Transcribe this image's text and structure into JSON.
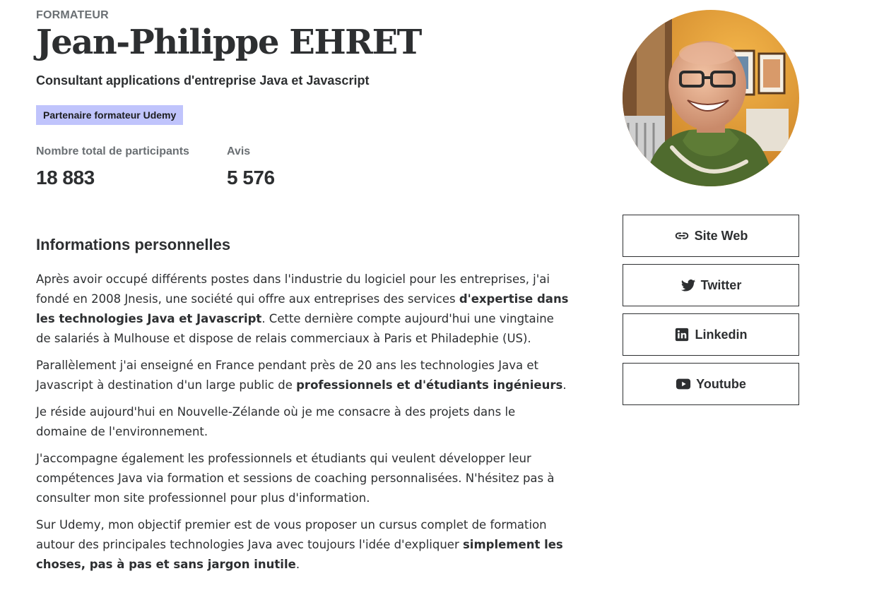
{
  "profile": {
    "eyebrow": "FORMATEUR",
    "name": "Jean-Philippe EHRET",
    "headline": "Consultant applications d'entreprise Java et Javascript",
    "badge": "Partenaire formateur Udemy",
    "avatar_alt": "Jean-Philippe EHRET"
  },
  "stats": [
    {
      "label": "Nombre total de participants",
      "value": "18 883"
    },
    {
      "label": "Avis",
      "value": "5 576"
    }
  ],
  "about": {
    "title": "Informations personnelles",
    "p1": {
      "t1": "Après avoir occupé différents postes dans l'industrie du logiciel pour les entreprises, j'ai fondé en 2008 Jnesis, une société qui offre aux entreprises des services ",
      "b1": "d'expertise dans les technologies Java et Javascript",
      "t2": ". Cette dernière compte aujourd'hui une vingtaine de salariés à Mulhouse et dispose de relais commerciaux à Paris et Philadephie (US)."
    },
    "p2": {
      "t1": "Parallèlement j'ai enseigné en France pendant près de 20 ans les technologies Java et Javascript à destination d'un large public de ",
      "b1": "professionnels et d'étudiants ingénieurs",
      "t2": "."
    },
    "p3": "Je réside aujourd'hui en Nouvelle-Zélande où je me consacre à des projets dans le domaine de l'environnement.",
    "p4": "J'accompagne également les professionnels et étudiants qui veulent développer leur compétences Java via formation et sessions de coaching personnalisées. N'hésitez pas à consulter mon site professionnel pour plus d'information.",
    "p5": {
      "t1": "Sur Udemy, mon objectif premier est de vous proposer un cursus complet de formation autour des principales technologies Java avec toujours l'idée d'expliquer ",
      "b1": "simplement les choses, pas à pas et sans jargon inutile",
      "t2": "."
    }
  },
  "links": [
    {
      "label": "Site Web",
      "icon": "link-icon"
    },
    {
      "label": "Twitter",
      "icon": "twitter-icon"
    },
    {
      "label": "Linkedin",
      "icon": "linkedin-icon"
    },
    {
      "label": "Youtube",
      "icon": "youtube-icon"
    }
  ],
  "colors": {
    "badge_bg": "#c0c4fc",
    "text": "#2d2f31",
    "muted": "#6a6f73"
  }
}
